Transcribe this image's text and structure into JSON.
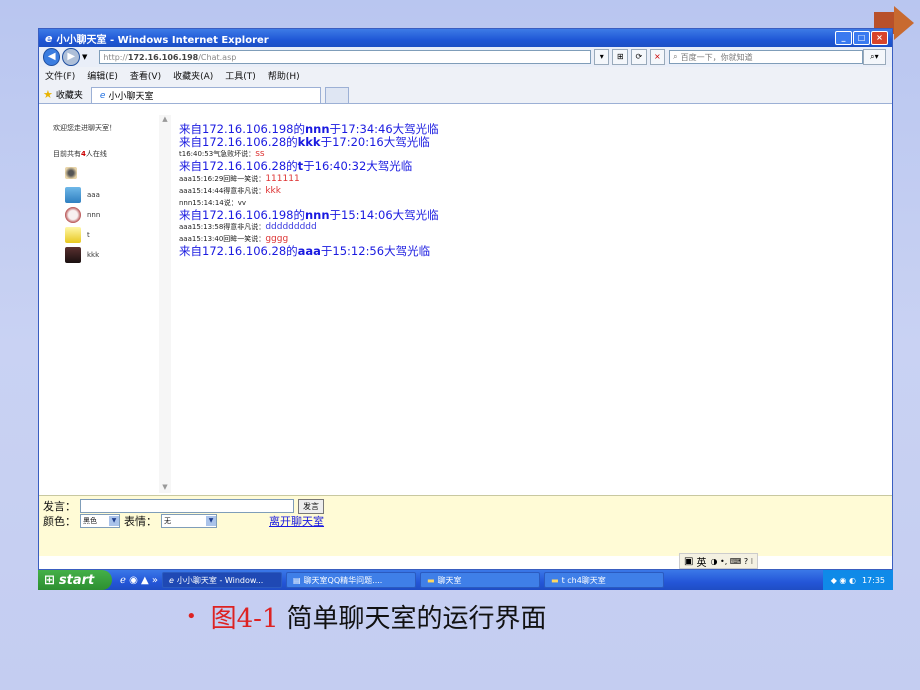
{
  "window": {
    "title": "小小聊天室 - Windows Internet Explorer"
  },
  "addressbar": {
    "url": "http://172.16.106.198/Chat.asp",
    "url_proto": "http://",
    "url_host": "172.16.106.198",
    "url_path": "/Chat.asp",
    "search_placeholder": "百度一下，你就知道"
  },
  "menubar": {
    "items": [
      "文件(F)",
      "编辑(E)",
      "查看(V)",
      "收藏夹(A)",
      "工具(T)",
      "帮助(H)"
    ]
  },
  "tabs": {
    "favorites": "收藏夹",
    "active_tab": "小小聊天室"
  },
  "sidebar": {
    "welcome": "欢迎您走进聊天室！",
    "online_prefix": "目前共有",
    "online_count": "4",
    "online_suffix": "人在线",
    "users": [
      "aaa",
      "nnn",
      "t",
      "kkk"
    ]
  },
  "messages": [
    {
      "type": "big",
      "text": "来自172.16.106.198的",
      "user": "nnn",
      "rest": "于17:34:46大驾光临"
    },
    {
      "type": "big",
      "text": "来自172.16.106.28的",
      "user": "kkk",
      "rest": "于17:20:16大驾光临"
    },
    {
      "type": "small",
      "prefix": "t16:40:53气急败坏说：",
      "content": "ss",
      "color": "red"
    },
    {
      "type": "big",
      "text": "来自172.16.106.28的",
      "user": "t",
      "rest": "于16:40:32大驾光临"
    },
    {
      "type": "small",
      "prefix": "aaa15:16:29回眸一笑说：",
      "content": "111111",
      "color": "red"
    },
    {
      "type": "small",
      "prefix": "aaa15:14:44得意非凡说：",
      "content": "kkk",
      "color": "red"
    },
    {
      "type": "small",
      "prefix": "nnn15:14:14说：",
      "content": "vv",
      "color": "black"
    },
    {
      "type": "big",
      "text": "来自172.16.106.198的",
      "user": "nnn",
      "rest": "于15:14:06大驾光临"
    },
    {
      "type": "small",
      "prefix": "aaa15:13:58得意非凡说：",
      "content": "ddddddddd",
      "color": "blue"
    },
    {
      "type": "small",
      "prefix": "aaa15:13:40回眸一笑说：",
      "content": "gggg",
      "color": "red"
    },
    {
      "type": "big",
      "text": "来自172.16.106.28的",
      "user": "aaa",
      "rest": "于15:12:56大驾光临"
    }
  ],
  "form": {
    "speak_label": "发言：",
    "speak_button": "发言",
    "color_label": "颜色：",
    "color_value": "黑色",
    "emotion_label": "表情：",
    "emotion_value": "无",
    "leave_link": "离开聊天室"
  },
  "langbar": {
    "text": "英"
  },
  "taskbar": {
    "start": "start",
    "tasks": [
      "小小聊天室 - Window...",
      "聊天室QQ精华问题....",
      "聊天室",
      "t ch4聊天室"
    ],
    "clock": "17:35"
  },
  "caption": {
    "bullet": "•",
    "label": "图4-1",
    "text": "简单聊天室的运行界面"
  }
}
